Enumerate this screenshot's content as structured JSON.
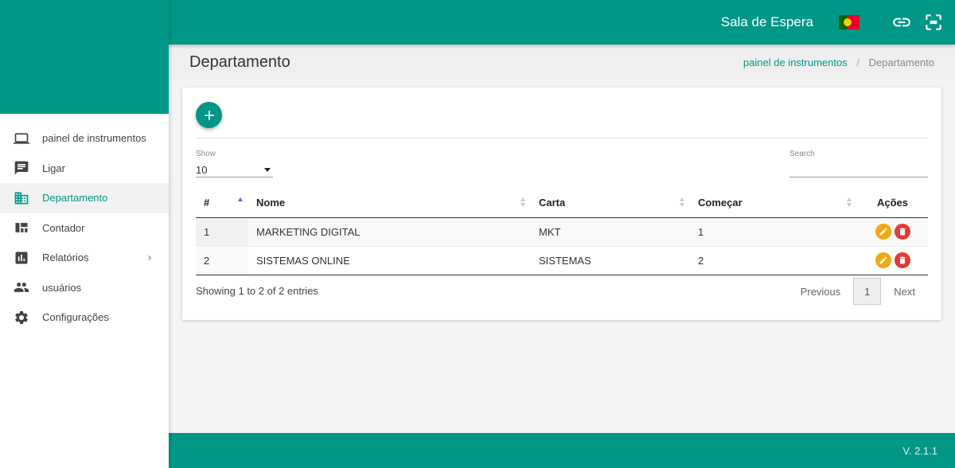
{
  "topbar": {
    "title": "Sala de Espera",
    "flag_icon": "portugal-flag-icon",
    "link_icon": "link-icon",
    "fullscreen_icon": "fullscreen-icon"
  },
  "sidebar": {
    "items": [
      {
        "label": "painel de instrumentos",
        "icon": "laptop-icon"
      },
      {
        "label": "Ligar",
        "icon": "chat-icon"
      },
      {
        "label": "Departamento",
        "icon": "building-icon",
        "active": true
      },
      {
        "label": "Contador",
        "icon": "dashboard-icon"
      },
      {
        "label": "Relatórios",
        "icon": "chart-icon",
        "has_submenu": true
      },
      {
        "label": "usuários",
        "icon": "users-icon"
      },
      {
        "label": "Configurações",
        "icon": "gear-icon"
      }
    ]
  },
  "header": {
    "page_title": "Departamento",
    "breadcrumb": {
      "home": "painel de instrumentos",
      "current": "Departamento"
    }
  },
  "table_controls": {
    "show_label": "Show",
    "show_value": "10",
    "search_label": "Search"
  },
  "table": {
    "columns": [
      "#",
      "Nome",
      "Carta",
      "Começar",
      "Ações"
    ],
    "rows": [
      {
        "id": "1",
        "nome": "MARKETING DIGITAL",
        "carta": "MKT",
        "comecar": "1"
      },
      {
        "id": "2",
        "nome": "SISTEMAS ONLINE",
        "carta": "SISTEMAS",
        "comecar": "2"
      }
    ]
  },
  "pagination": {
    "info": "Showing 1 to 2 of 2 entries",
    "previous": "Previous",
    "page": "1",
    "next": "Next"
  },
  "footer": {
    "version": "V. 2.1.1"
  },
  "colors": {
    "primary": "#009688",
    "edit": "#f3a712",
    "delete": "#e53935"
  }
}
